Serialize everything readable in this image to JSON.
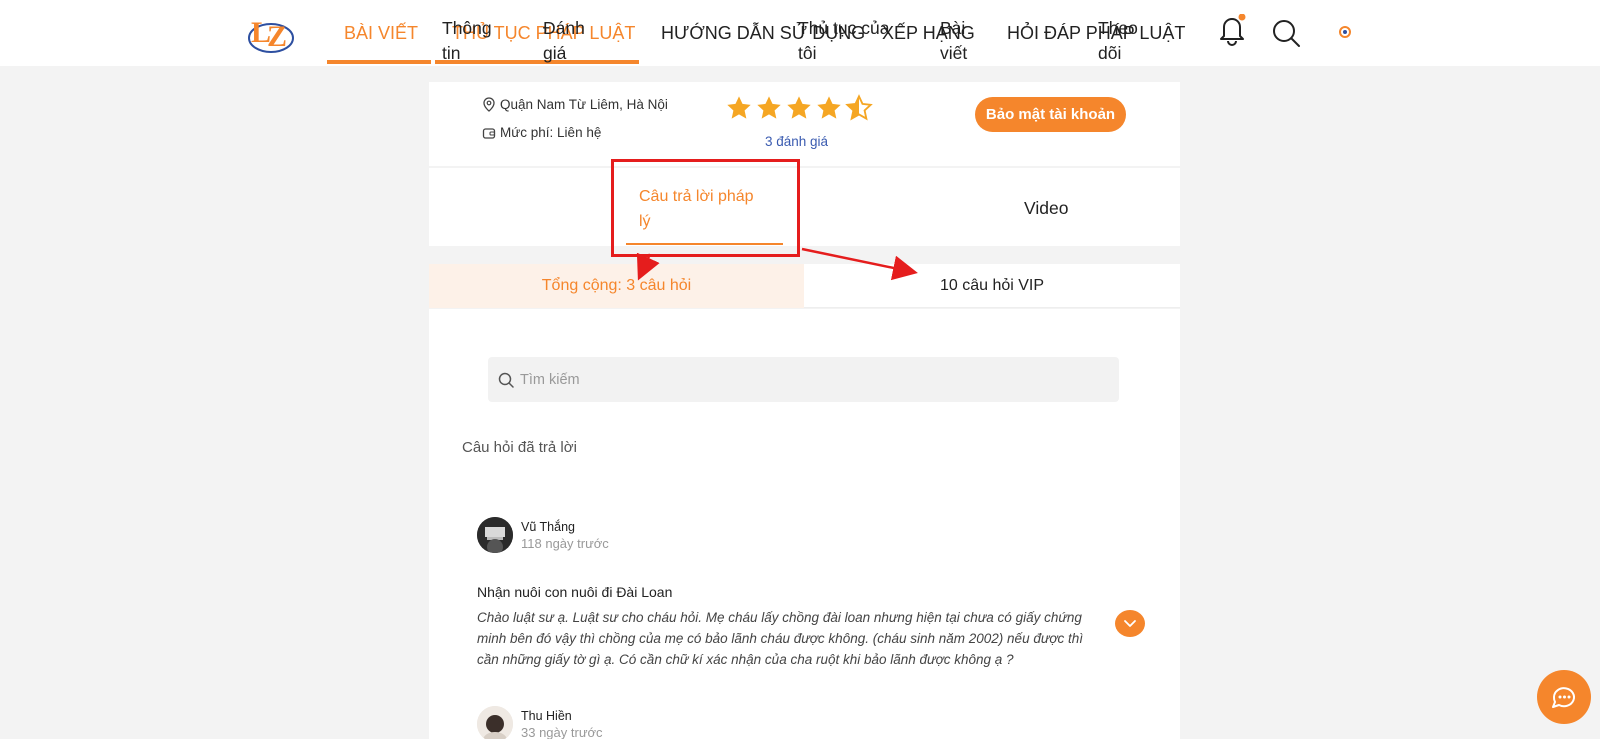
{
  "header": {
    "nav": [
      {
        "label": "BÀI VIẾT"
      },
      {
        "label": "THỦ TỤC PHÁP LUẬT"
      },
      {
        "label": "HƯỚNG DẪN SỬ DỤNG"
      },
      {
        "label": "XẾP HẠNG"
      },
      {
        "label": "HỎI ĐÁP PHÁP LUẬT"
      }
    ],
    "icons": [
      "bell-icon",
      "search-icon",
      "user-avatar-icon"
    ]
  },
  "profile": {
    "location": "Quận Nam Từ Liêm, Hà Nội",
    "fee": "Mức phí: Liên hệ",
    "rating": 4.5,
    "rating_count": "3 đánh giá",
    "secure_button": "Bảo mật tài khoản"
  },
  "tabs": [
    {
      "label": "Thông tin"
    },
    {
      "label": "Đánh giá"
    },
    {
      "label": "Câu trả lời pháp lý"
    },
    {
      "label": "Thủ tục của tôi"
    },
    {
      "label": "Bài viết"
    },
    {
      "label": "Video"
    },
    {
      "label": "Theo dõi"
    }
  ],
  "subtabs": {
    "total": "Tổng cộng: 3 câu hỏi",
    "vip": "10 câu hỏi VIP"
  },
  "search": {
    "placeholder": "Tìm kiếm"
  },
  "section_title": "Câu hỏi đã trả lời",
  "questions": [
    {
      "author": "Vũ Thắng",
      "time": "118 ngày trước",
      "title": "Nhận nuôi con nuôi đi Đài Loan",
      "body": "Chào luật sư ạ. Luật sư cho cháu hỏi. Mẹ cháu lấy chồng đài loan nhưng hiện tại chưa có giấy chứng minh bên đó vậy thì chồng của mẹ có bảo lãnh cháu được không. (cháu sinh năm 2002) nếu được thì cần những giấy tờ gì ạ. Có cần chữ kí xác nhận của cha ruột khi bảo lãnh được không ạ ?"
    },
    {
      "author": "Thu Hiền",
      "time": "33 ngày trước"
    }
  ],
  "colors": {
    "accent": "#f5862c",
    "annotation": "#e51d1d",
    "link": "#3a5bb0"
  }
}
